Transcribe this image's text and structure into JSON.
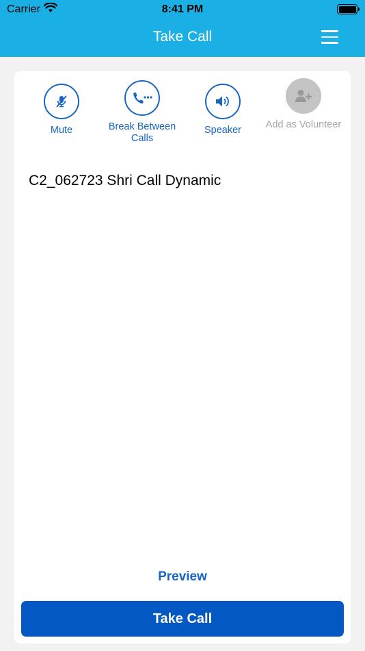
{
  "status_bar": {
    "carrier": "Carrier",
    "time": "8:41 PM"
  },
  "nav": {
    "title": "Take Call",
    "menu_icon": "hamburger-menu-icon"
  },
  "actions": [
    {
      "label": "Mute",
      "icon": "microphone-off-icon",
      "enabled": true
    },
    {
      "label": "Break Between Calls",
      "icon": "phone-break-icon",
      "enabled": true
    },
    {
      "label": "Speaker",
      "icon": "speaker-icon",
      "enabled": true
    },
    {
      "label": "Add as Volunteer",
      "icon": "add-user-icon",
      "enabled": false
    }
  ],
  "call": {
    "name": "C2_062723 Shri Call Dynamic"
  },
  "footer": {
    "preview_label": "Preview",
    "take_call_label": "Take Call"
  },
  "colors": {
    "header_bg": "#1ab0e5",
    "accent": "#1766c4",
    "primary_button": "#0358c4",
    "disabled": "#c4c4c4"
  }
}
